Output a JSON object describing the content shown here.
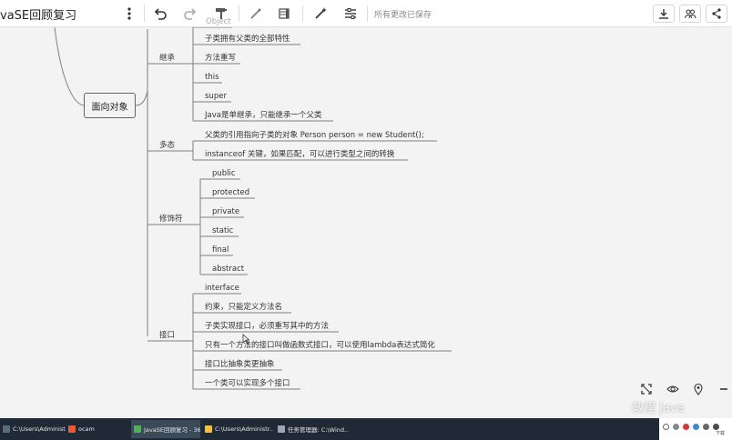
{
  "toolbar": {
    "doc_title": "vaSE回顾复习",
    "save_status": "所有更改已保存"
  },
  "mindmap": {
    "partial_top": "Object",
    "root": "面向对象",
    "branches": [
      {
        "label": "继承",
        "children": [
          "子类拥有父类的全部特性",
          "方法重写",
          "this",
          "super",
          "Java是单继承，只能继承一个父类"
        ]
      },
      {
        "label": "多态",
        "children": [
          "父类的引用指向子类的对象  Person person = new Student();",
          "instanceof 关键，如果匹配，可以进行类型之间的转换"
        ]
      },
      {
        "label": "修饰符",
        "children": [
          "public",
          "protected",
          "private",
          "static",
          "final",
          "abstract"
        ]
      },
      {
        "label": "接口",
        "children": [
          "interface",
          "约束，只能定义方法名",
          "子类实现接口，必须重写其中的方法",
          "只有一个方法的接口叫做函数式接口，可以使用lambda表达式简化",
          "接口比抽象类更抽象",
          "一个类可以实现多个接口"
        ]
      }
    ]
  },
  "icons": {
    "more": "more-vertical-icon",
    "undo": "undo-icon",
    "redo": "redo-icon",
    "format_painter": "format-painter-icon",
    "insert": "insert-icon",
    "style": "style-icon",
    "magic": "magic-wand-icon",
    "structure": "structure-icon",
    "download": "download-icon",
    "share_people": "people-icon",
    "share": "share-icon",
    "fit": "fit-screen-icon",
    "eye": "eye-icon",
    "locate": "location-icon",
    "zoom_out": "minus-icon"
  },
  "watermark": "教程 Java",
  "taskbar": {
    "items": [
      "C:\\Users\\Administr...",
      "ocam",
      "JavaSE回顾复习 - 36...",
      "C:\\Users\\Administr...",
      "任务管理器: C:\\Wind..."
    ],
    "tray_label": "下载"
  },
  "colors": {
    "canvas_bg": "#f3f3f3",
    "line": "#7f7f7f",
    "taskbar_bg": "#1f2a36"
  }
}
